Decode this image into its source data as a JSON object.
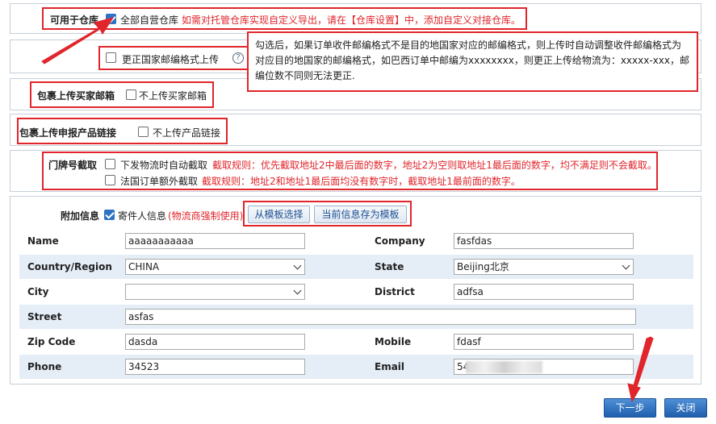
{
  "warehouse": {
    "label": "可用于仓库",
    "option": "全部自营仓库",
    "note": "如需对托管仓库实现自定义导出，请在【仓库设置】中，添加自定义对接仓库。"
  },
  "postal_format": {
    "option": "更正国家邮编格式上传",
    "help_icon": "?",
    "tooltip": "勾选后，如果订单收件邮编格式不是目的地国家对应的邮编格式，则上传时自动调整收件邮编格式为对应目的地国家的邮编格式，如巴西订单中邮编为xxxxxxxx，则更正上传给物流为：xxxxx-xxx，邮编位数不同则无法更正."
  },
  "buyer_email": {
    "label": "包裹上传买家邮箱",
    "option": "不上传买家邮箱"
  },
  "product_link": {
    "label": "包裹上传申报产品链接",
    "option": "不上传产品链接"
  },
  "house_number": {
    "label": "门牌号截取",
    "option1": "下发物流时自动截取",
    "rule1": "截取规则：优先截取地址2中最后面的数字，地址2为空则取地址1最后面的数字，均不满足则不会截取。",
    "option2": "法国订单额外截取",
    "rule2": "截取规则：地址2和地址1最后面均没有数字时，截取地址1最前面的数字。"
  },
  "extra_info": {
    "label": "附加信息",
    "sender_option": "寄件人信息",
    "sender_note": "(物流商强制使用)",
    "template_select": "从模板选择",
    "save_template": "当前信息存为模板"
  },
  "form": {
    "name_label": "Name",
    "name_value": "aaaaaaaaaaa",
    "company_label": "Company",
    "company_value": "fasfdas",
    "country_label": "Country/Region",
    "country_value": "CHINA",
    "state_label": "State",
    "state_value": "Beijing北京",
    "city_label": "City",
    "city_value": "",
    "district_label": "District",
    "district_value": "adfsa",
    "street_label": "Street",
    "street_value": "asfas",
    "zip_label": "Zip Code",
    "zip_value": "dasda",
    "mobile_label": "Mobile",
    "mobile_value": "fdasf",
    "phone_label": "Phone",
    "phone_value": "34523",
    "email_label": "Email",
    "email_value": "54"
  },
  "footer": {
    "next": "下一步",
    "close": "关闭"
  },
  "colors": {
    "highlight": "#e0252b",
    "row_alt": "#e5edf7",
    "primary": "#1f5fae"
  }
}
